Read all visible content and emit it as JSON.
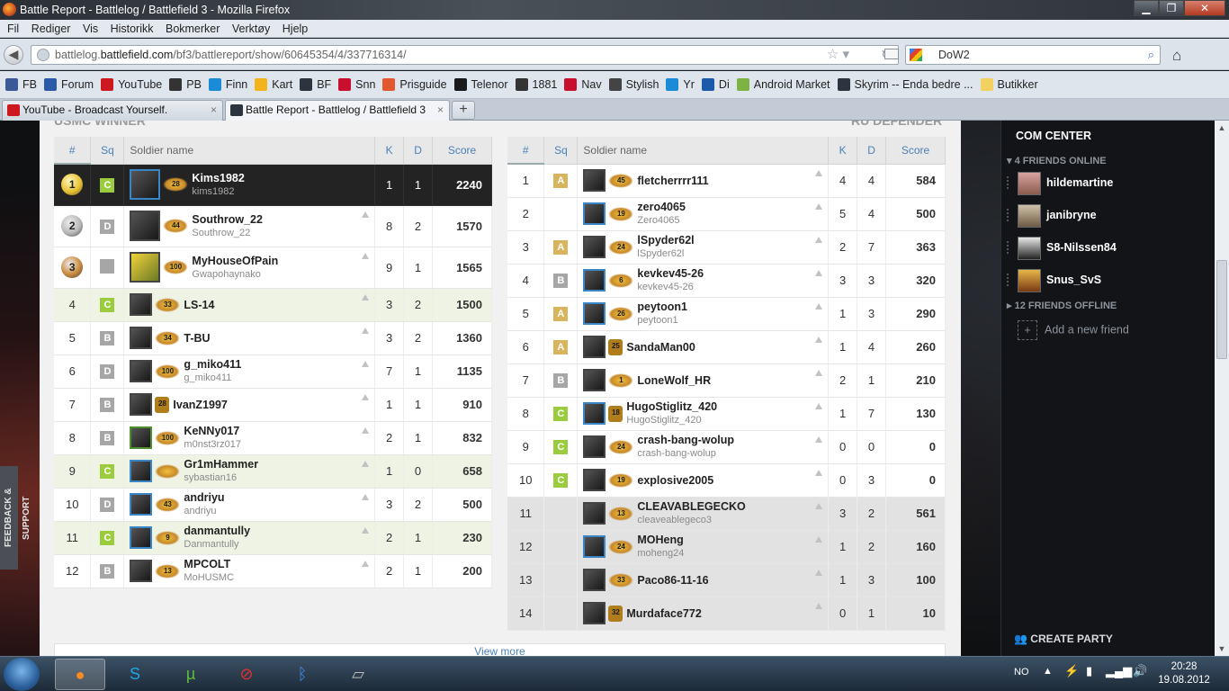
{
  "window": {
    "title": "Battle Report - Battlelog / Battlefield 3 - Mozilla Firefox",
    "buttons": [
      "▁",
      "❐",
      "✕"
    ]
  },
  "menu": [
    "Fil",
    "Rediger",
    "Vis",
    "Historikk",
    "Bokmerker",
    "Verktøy",
    "Hjelp"
  ],
  "url": {
    "prefix": "battlelog.",
    "host": "battlefield.com",
    "path": "/bf3/battlereport/show/60645354/4/337716314/"
  },
  "search": {
    "value": "DoW2"
  },
  "bookmarks": [
    {
      "label": "FB",
      "color": "#3b5998"
    },
    {
      "label": "Forum",
      "color": "#2b5aa8"
    },
    {
      "label": "YouTube",
      "color": "#cc181e"
    },
    {
      "label": "PB",
      "color": "#333333"
    },
    {
      "label": "Finn",
      "color": "#1a8bd6"
    },
    {
      "label": "Kart",
      "color": "#f2b31b"
    },
    {
      "label": "BF",
      "color": "#2c3440"
    },
    {
      "label": "Snn",
      "color": "#c8102e"
    },
    {
      "label": "Prisguide",
      "color": "#e2572d"
    },
    {
      "label": "Telenor",
      "color": "#1a1a1a"
    },
    {
      "label": "1881",
      "color": "#333333"
    },
    {
      "label": "Nav",
      "color": "#c8102e"
    },
    {
      "label": "Stylish",
      "color": "#444444"
    },
    {
      "label": "Yr",
      "color": "#1a8bd6"
    },
    {
      "label": "Di",
      "color": "#1a5aa8"
    },
    {
      "label": "Android Market",
      "color": "#7cb342"
    },
    {
      "label": "Skyrim -- Enda bedre ...",
      "color": "#2c3440"
    },
    {
      "label": "Butikker",
      "color": "#f2d15f"
    }
  ],
  "tabs": [
    {
      "label": "YouTube - Broadcast Yourself.",
      "close": "×"
    },
    {
      "label": "Battle Report - Battlelog / Battlefield 3",
      "close": "×"
    }
  ],
  "newtab": "+",
  "team_left": {
    "name": "USMC WINNER"
  },
  "team_right": {
    "name": "RU DEFENDER"
  },
  "headers": {
    "rank": "#",
    "squad": "Sq",
    "soldier": "Soldier name",
    "kills": "K",
    "deaths": "D",
    "score": "Score"
  },
  "left_rows": [
    {
      "pos": "1",
      "squad": "C",
      "name": "Kims1982",
      "sub": "kims1982",
      "rank": "28",
      "k": "1",
      "d": "1",
      "score": "2240"
    },
    {
      "pos": "2",
      "squad": "D",
      "name": "Southrow_22",
      "sub": "Southrow_22",
      "rank": "44",
      "k": "8",
      "d": "2",
      "score": "1570"
    },
    {
      "pos": "3",
      "squad": "",
      "name": "MyHouseOfPain",
      "sub": "Gwapohaynako",
      "rank": "100",
      "k": "9",
      "d": "1",
      "score": "1565"
    },
    {
      "pos": "4",
      "squad": "C",
      "name": "LS-14",
      "sub": "",
      "rank": "33",
      "k": "3",
      "d": "2",
      "score": "1500"
    },
    {
      "pos": "5",
      "squad": "B",
      "name": "T-BU",
      "sub": "",
      "rank": "34",
      "k": "3",
      "d": "2",
      "score": "1360"
    },
    {
      "pos": "6",
      "squad": "D",
      "name": "g_miko411",
      "sub": "g_miko411",
      "rank": "100",
      "k": "7",
      "d": "1",
      "score": "1135"
    },
    {
      "pos": "7",
      "squad": "B",
      "name": "IvanZ1997",
      "sub": "",
      "rank": "28",
      "k": "1",
      "d": "1",
      "score": "910"
    },
    {
      "pos": "8",
      "squad": "B",
      "name": "KeNNy017",
      "sub": "m0nst3rz017",
      "rank": "100",
      "k": "2",
      "d": "1",
      "score": "832"
    },
    {
      "pos": "9",
      "squad": "C",
      "name": "Gr1mHammer",
      "sub": "sybastian16",
      "rank": "",
      "k": "1",
      "d": "0",
      "score": "658"
    },
    {
      "pos": "10",
      "squad": "D",
      "name": "andriyu",
      "sub": "andriyu",
      "rank": "43",
      "k": "3",
      "d": "2",
      "score": "500"
    },
    {
      "pos": "11",
      "squad": "C",
      "name": "danmantully",
      "sub": "Danmantully",
      "rank": "9",
      "k": "2",
      "d": "1",
      "score": "230"
    },
    {
      "pos": "12",
      "squad": "B",
      "name": "MPCOLT",
      "sub": "MoHUSMC",
      "rank": "13",
      "k": "2",
      "d": "1",
      "score": "200"
    }
  ],
  "right_rows": [
    {
      "pos": "1",
      "squad": "A",
      "name": "fletcherrrr111",
      "sub": "",
      "rank": "45",
      "k": "4",
      "d": "4",
      "score": "584"
    },
    {
      "pos": "2",
      "squad": "",
      "name": "zero4065",
      "sub": "Zero4065",
      "rank": "19",
      "k": "5",
      "d": "4",
      "score": "500"
    },
    {
      "pos": "3",
      "squad": "A",
      "name": "lSpyder62l",
      "sub": "lSpyder62l",
      "rank": "24",
      "k": "2",
      "d": "7",
      "score": "363"
    },
    {
      "pos": "4",
      "squad": "B",
      "name": "kevkev45-26",
      "sub": "kevkev45-26",
      "rank": "6",
      "k": "3",
      "d": "3",
      "score": "320"
    },
    {
      "pos": "5",
      "squad": "A",
      "name": "peytoon1",
      "sub": "peytoon1",
      "rank": "26",
      "k": "1",
      "d": "3",
      "score": "290"
    },
    {
      "pos": "6",
      "squad": "A",
      "name": "SandaMan00",
      "sub": "",
      "rank": "25",
      "k": "1",
      "d": "4",
      "score": "260"
    },
    {
      "pos": "7",
      "squad": "B",
      "name": "LoneWolf_HR",
      "sub": "",
      "rank": "1",
      "k": "2",
      "d": "1",
      "score": "210"
    },
    {
      "pos": "8",
      "squad": "C",
      "name": "HugoStiglitz_420",
      "sub": "HugoStiglitz_420",
      "rank": "18",
      "k": "1",
      "d": "7",
      "score": "130"
    },
    {
      "pos": "9",
      "squad": "C",
      "name": "crash-bang-wolup",
      "sub": "crash-bang-wolup",
      "rank": "24",
      "k": "0",
      "d": "0",
      "score": "0"
    },
    {
      "pos": "10",
      "squad": "C",
      "name": "explosive2005",
      "sub": "",
      "rank": "19",
      "k": "0",
      "d": "3",
      "score": "0"
    },
    {
      "pos": "11",
      "squad": "",
      "name": "CLEAVABLEGECKO",
      "sub": "cleaveablegeco3",
      "rank": "13",
      "k": "3",
      "d": "2",
      "score": "561"
    },
    {
      "pos": "12",
      "squad": "",
      "name": "MOHeng",
      "sub": "moheng24",
      "rank": "24",
      "k": "1",
      "d": "2",
      "score": "160"
    },
    {
      "pos": "13",
      "squad": "",
      "name": "Paco86-11-16",
      "sub": "",
      "rank": "33",
      "k": "1",
      "d": "3",
      "score": "100"
    },
    {
      "pos": "14",
      "squad": "",
      "name": "Murdaface772",
      "sub": "",
      "rank": "32",
      "k": "0",
      "d": "1",
      "score": "10"
    }
  ],
  "viewmore": "View more",
  "com_center": {
    "title": "COM CENTER",
    "online_header": "4 FRIENDS ONLINE",
    "friends": [
      "hildemartine",
      "janibryne",
      "S8-Nilssen84",
      "Snus_SvS"
    ],
    "offline_header": "12 FRIENDS OFFLINE",
    "add_friend": "Add a new friend",
    "create_party": "CREATE PARTY"
  },
  "feedback": "FEEDBACK & SUPPORT",
  "taskbar": {
    "lang": "NO",
    "time": "20:28",
    "date": "19.08.2012"
  }
}
